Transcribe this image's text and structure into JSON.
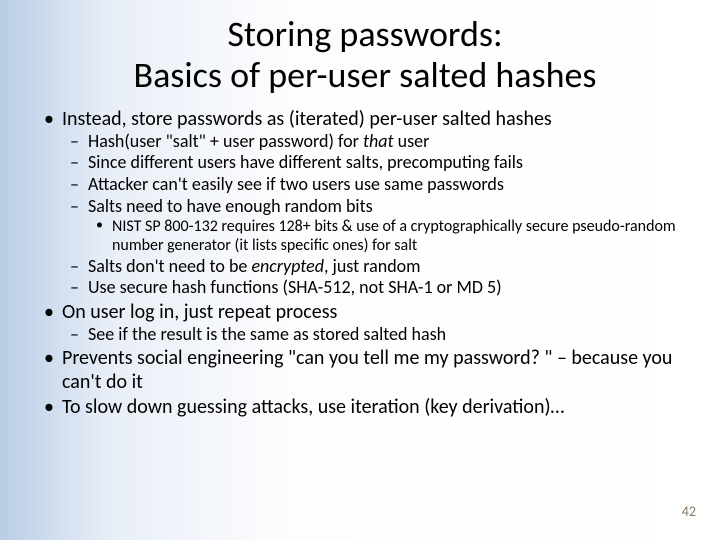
{
  "slide": {
    "title_line1": "Storing passwords:",
    "title_line2": "Basics of per-user salted hashes",
    "b1": "Instead, store passwords as (iterated) per-user salted hashes",
    "b1_1a": "Hash(user \"salt\" + user password) for ",
    "b1_1b": "that",
    "b1_1c": " user",
    "b1_2": "Since different users have different salts, precomputing fails",
    "b1_3": "Attacker can't easily see if two users use same passwords",
    "b1_4": "Salts need to have enough random bits",
    "b1_4_1": "NIST SP 800-132 requires 128+ bits & use of a cryptographically secure pseudo-random number generator (it lists specific ones) for salt",
    "b1_5a": "Salts don't need to be ",
    "b1_5b": "encrypted",
    "b1_5c": ", just random",
    "b1_6": "Use secure hash functions (SHA-512, not SHA-1 or MD 5)",
    "b2": "On user log in, just repeat process",
    "b2_1": "See if the result is the same as stored salted hash",
    "b3": "Prevents social engineering \"can you tell me my password? \" – because you can't do it",
    "b4": "To slow down guessing attacks, use iteration (key derivation)…",
    "page": "42"
  }
}
